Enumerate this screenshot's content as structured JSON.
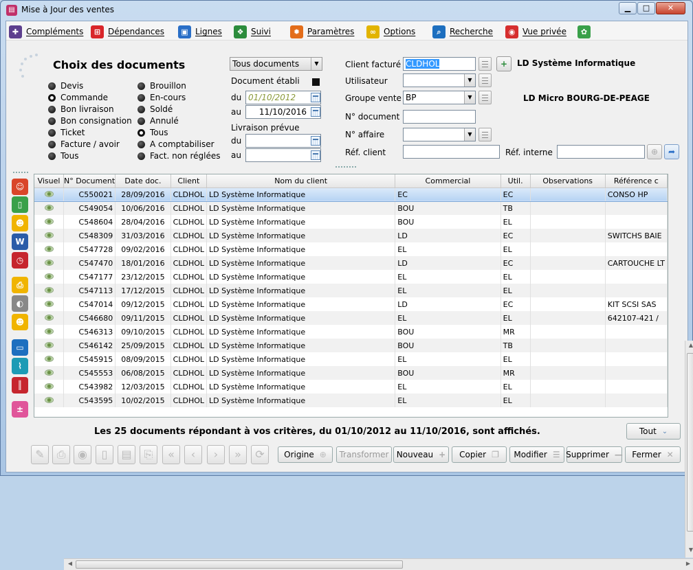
{
  "window": {
    "title": "Mise à Jour des ventes",
    "minimize": "▁",
    "maximize": "□",
    "close": "✕"
  },
  "menu": [
    {
      "label": "Compléments",
      "icon": "puzzle-icon",
      "color": "#5d3f8e"
    },
    {
      "label": "Dépendances",
      "icon": "hierarchy-icon",
      "color": "#d9262a"
    },
    {
      "label": "Lignes",
      "icon": "basket-icon",
      "color": "#2a6fc7"
    },
    {
      "label": "Suivi",
      "icon": "footsteps-icon",
      "color": "#2c8c3c"
    },
    {
      "label": "Paramètres",
      "icon": "gear-icon",
      "color": "#e36d1a"
    },
    {
      "label": "Options",
      "icon": "glasses-icon",
      "color": "#e2b400"
    },
    {
      "label": "Recherche",
      "icon": "magnifier-icon",
      "color": "#1d6fbf"
    },
    {
      "label": "Vue privée",
      "icon": "binoculars-icon",
      "color": "#d62f2f"
    },
    {
      "label": "",
      "icon": "palette-icon",
      "color": "#3aa04a"
    }
  ],
  "filters": {
    "title": "Choix des documents",
    "doc_types_left": [
      "Devis",
      "Commande",
      "Bon livraison",
      "Bon consignation",
      "Ticket",
      "Facture / avoir",
      "Tous"
    ],
    "doc_types_left_selected": 1,
    "doc_types_right": [
      "Brouillon",
      "En-cours",
      "Soldé",
      "Annulé",
      "Tous",
      "A comptabiliser",
      "Fact. non réglées"
    ],
    "doc_types_right_selected": 4,
    "doc_scope": "Tous documents",
    "doc_date_label": "Document établi",
    "du_label": "du",
    "au_label": "au",
    "doc_from": "01/10/2012",
    "doc_to": "11/10/2016",
    "delivery_label": "Livraison prévue",
    "delivery_from": "",
    "delivery_to": ""
  },
  "client": {
    "client_label": "Client facturé",
    "client_value": "CLDHOL",
    "client_name": "LD Système Informatique",
    "user_label": "Utilisateur",
    "user_value": "",
    "group_label": "Groupe vente",
    "group_value": "BP",
    "group_name": "LD Micro BOURG-DE-PEAGE",
    "doc_no_label": "N° document",
    "doc_no_value": "",
    "affaire_label": "N° affaire",
    "affaire_value": "",
    "ref_client_label": "Réf. client",
    "ref_client_value": "",
    "ref_interne_label": "Réf. interne",
    "ref_interne_value": ""
  },
  "table": {
    "columns": [
      "Visuel",
      "N° Document",
      "Date doc.",
      "Client",
      "Nom du client",
      "Commercial",
      "Util.",
      "Observations",
      "Référence c"
    ],
    "rows": [
      [
        "C550021",
        "28/09/2016",
        "CLDHOL",
        "LD Système Informatique",
        "EC",
        "EC",
        "",
        "CONSO HP"
      ],
      [
        "C549054",
        "10/06/2016",
        "CLDHOL",
        "LD Système Informatique",
        "BOU",
        "TB",
        "",
        ""
      ],
      [
        "C548604",
        "28/04/2016",
        "CLDHOL",
        "LD Système Informatique",
        "BOU",
        "EL",
        "",
        ""
      ],
      [
        "C548309",
        "31/03/2016",
        "CLDHOL",
        "LD Système Informatique",
        "LD",
        "EC",
        "",
        "SWITCHS BAIE"
      ],
      [
        "C547728",
        "09/02/2016",
        "CLDHOL",
        "LD Système Informatique",
        "EL",
        "EL",
        "",
        ""
      ],
      [
        "C547470",
        "18/01/2016",
        "CLDHOL",
        "LD Système Informatique",
        "LD",
        "EC",
        "",
        "CARTOUCHE LT"
      ],
      [
        "C547177",
        "23/12/2015",
        "CLDHOL",
        "LD Système Informatique",
        "EL",
        "EL",
        "",
        ""
      ],
      [
        "C547113",
        "17/12/2015",
        "CLDHOL",
        "LD Système Informatique",
        "EL",
        "EL",
        "",
        ""
      ],
      [
        "C547014",
        "09/12/2015",
        "CLDHOL",
        "LD Système Informatique",
        "LD",
        "EC",
        "",
        "KIT SCSI SAS"
      ],
      [
        "C546680",
        "09/11/2015",
        "CLDHOL",
        "LD Système Informatique",
        "EL",
        "EL",
        "",
        "642107-421 /"
      ],
      [
        "C546313",
        "09/10/2015",
        "CLDHOL",
        "LD Système Informatique",
        "BOU",
        "MR",
        "",
        ""
      ],
      [
        "C546142",
        "25/09/2015",
        "CLDHOL",
        "LD Système Informatique",
        "BOU",
        "TB",
        "",
        ""
      ],
      [
        "C545915",
        "08/09/2015",
        "CLDHOL",
        "LD Système Informatique",
        "EL",
        "EL",
        "",
        ""
      ],
      [
        "C545553",
        "06/08/2015",
        "CLDHOL",
        "LD Système Informatique",
        "BOU",
        "MR",
        "",
        ""
      ],
      [
        "C543982",
        "12/03/2015",
        "CLDHOL",
        "LD Système Informatique",
        "EL",
        "EL",
        "",
        ""
      ],
      [
        "C543595",
        "10/02/2015",
        "CLDHOL",
        "LD Système Informatique",
        "EL",
        "EL",
        "",
        ""
      ]
    ],
    "selected_row": 0
  },
  "status": {
    "text": "Les 25 documents répondant à vos critères, du 01/10/2012 au 11/10/2016, sont affichés.",
    "all_button": "Tout"
  },
  "buttons": {
    "origine": "Origine",
    "transformer": "Transformer",
    "nouveau": "Nouveau",
    "copier": "Copier",
    "modifier": "Modifier",
    "supprimer": "Supprimer",
    "fermer": "Fermer"
  },
  "side_icons": [
    {
      "icon": "user-icon",
      "color": "#d9462a"
    },
    {
      "icon": "phone-icon",
      "color": "#3aa04a"
    },
    {
      "icon": "contact-card-icon",
      "color": "#f0b400"
    },
    {
      "icon": "word-document-icon",
      "color": "#2b5ca8"
    },
    {
      "icon": "alarm-clock-icon",
      "color": "#c6262e"
    },
    {
      "icon": "printer-icon",
      "color": "#f0b400"
    },
    {
      "icon": "disc-icon",
      "color": "#888888"
    },
    {
      "icon": "person-card-icon",
      "color": "#f0b400"
    },
    {
      "icon": "folder-icon",
      "color": "#1d6fbf"
    },
    {
      "icon": "paperclip-icon",
      "color": "#1e9bb5"
    },
    {
      "icon": "barcode-icon",
      "color": "#c6262e"
    },
    {
      "icon": "calculator-icon",
      "color": "#e0559a"
    }
  ]
}
